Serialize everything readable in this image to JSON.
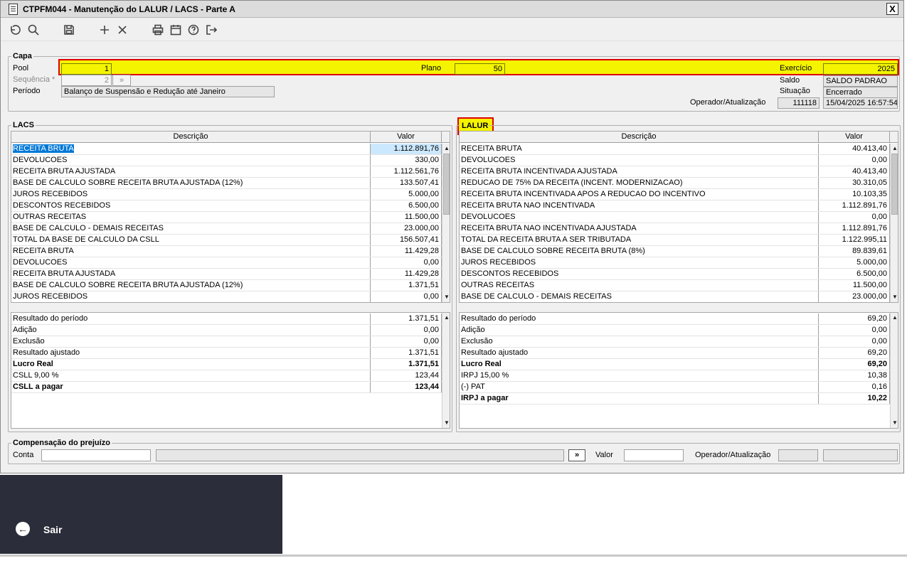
{
  "window": {
    "title": "CTPFM044 - Manutenção do LALUR / LACS - Parte A",
    "close_label": "X"
  },
  "toolbar": {
    "icons": [
      "undo-icon",
      "search-icon",
      "save-icon",
      "add-icon",
      "delete-icon",
      "print-icon",
      "calendar-icon",
      "help-icon",
      "exit-icon"
    ]
  },
  "capa": {
    "legend": "Capa",
    "pool_label": "Pool",
    "pool_value": "1",
    "plano_label": "Plano",
    "plano_value": "50",
    "exercicio_label": "Exercício",
    "exercicio_value": "2025",
    "sequencia_label": "Sequência *",
    "sequencia_value": "2",
    "sequencia_btn": "»",
    "periodo_label": "Período",
    "periodo_value": "Balanço de Suspensão e Redução até Janeiro",
    "saldo_label": "Saldo",
    "saldo_value": "SALDO PADRAO",
    "situacao_label": "Situação",
    "situacao_value": "Encerrado",
    "operador_label": "Operador/Atualização",
    "operador_value": "111118",
    "atualizacao_value": "15/04/2025 16:57:54"
  },
  "lacs": {
    "legend": "LACS",
    "col_desc": "Descrição",
    "col_valor": "Valor",
    "rows": [
      {
        "d": "RECEITA BRUTA",
        "v": "1.112.891,76"
      },
      {
        "d": "DEVOLUCOES",
        "v": "330,00"
      },
      {
        "d": "RECEITA BRUTA AJUSTADA",
        "v": "1.112.561,76"
      },
      {
        "d": "BASE DE CALCULO SOBRE RECEITA BRUTA AJUSTADA (12%)",
        "v": "133.507,41"
      },
      {
        "d": "JUROS RECEBIDOS",
        "v": "5.000,00"
      },
      {
        "d": "DESCONTOS RECEBIDOS",
        "v": "6.500,00"
      },
      {
        "d": "OUTRAS RECEITAS",
        "v": "11.500,00"
      },
      {
        "d": "BASE DE CALCULO - DEMAIS RECEITAS",
        "v": "23.000,00"
      },
      {
        "d": "TOTAL DA BASE DE CALCULO DA CSLL",
        "v": "156.507,41"
      },
      {
        "d": "RECEITA BRUTA",
        "v": "11.429,28"
      },
      {
        "d": "DEVOLUCOES",
        "v": "0,00"
      },
      {
        "d": "RECEITA BRUTA AJUSTADA",
        "v": "11.429,28"
      },
      {
        "d": "BASE DE CALCULO SOBRE RECEITA BRUTA AJUSTADA (12%)",
        "v": "1.371,51"
      },
      {
        "d": "JUROS RECEBIDOS",
        "v": "0,00"
      }
    ],
    "summary": [
      {
        "d": "Resultado do período",
        "v": "1.371,51"
      },
      {
        "d": "Adição",
        "v": "0,00"
      },
      {
        "d": "Exclusão",
        "v": "0,00"
      },
      {
        "d": "Resultado ajustado",
        "v": "1.371,51"
      },
      {
        "d": "Lucro Real",
        "v": "1.371,51",
        "bold": true
      },
      {
        "d": "CSLL 9,00 %",
        "v": "123,44"
      },
      {
        "d": "CSLL a pagar",
        "v": "123,44",
        "bold": true
      }
    ]
  },
  "lalur": {
    "legend": "LALUR",
    "col_desc": "Descrição",
    "col_valor": "Valor",
    "rows": [
      {
        "d": "RECEITA BRUTA",
        "v": "40.413,40"
      },
      {
        "d": "DEVOLUCOES",
        "v": "0,00"
      },
      {
        "d": "RECEITA BRUTA INCENTIVADA AJUSTADA",
        "v": "40.413,40"
      },
      {
        "d": "REDUCAO DE 75% DA RECEITA (INCENT. MODERNIZACAO)",
        "v": "30.310,05"
      },
      {
        "d": "RECEITA BRUTA INCENTIVADA APOS A REDUCAO DO INCENTIVO",
        "v": "10.103,35"
      },
      {
        "d": "RECEITA BRUTA NAO INCENTIVADA",
        "v": "1.112.891,76"
      },
      {
        "d": "DEVOLUCOES",
        "v": "0,00"
      },
      {
        "d": "RECEITA BRUTA NAO INCENTIVADA AJUSTADA",
        "v": "1.112.891,76"
      },
      {
        "d": "TOTAL DA RECEITA BRUTA A SER TRIBUTADA",
        "v": "1.122.995,11"
      },
      {
        "d": "BASE DE CALCULO SOBRE RECEITA BRUTA (8%)",
        "v": "89.839,61"
      },
      {
        "d": "JUROS RECEBIDOS",
        "v": "5.000,00"
      },
      {
        "d": "DESCONTOS RECEBIDOS",
        "v": "6.500,00"
      },
      {
        "d": "OUTRAS RECEITAS",
        "v": "11.500,00"
      },
      {
        "d": "BASE DE CALCULO - DEMAIS RECEITAS",
        "v": "23.000,00"
      }
    ],
    "summary": [
      {
        "d": "Resultado do período",
        "v": "69,20"
      },
      {
        "d": "Adição",
        "v": "0,00"
      },
      {
        "d": "Exclusão",
        "v": "0,00"
      },
      {
        "d": "Resultado ajustado",
        "v": "69,20"
      },
      {
        "d": "Lucro Real",
        "v": "69,20",
        "bold": true
      },
      {
        "d": "IRPJ 15,00 %",
        "v": "10,38"
      },
      {
        "d": "(-) PAT",
        "v": "0,16"
      },
      {
        "d": "IRPJ a pagar",
        "v": "10,22",
        "bold": true
      }
    ]
  },
  "compensacao": {
    "legend": "Compensação do prejuízo",
    "conta_label": "Conta",
    "conta_value": "",
    "conta_btn": "»",
    "valor_label": "Valor",
    "valor_value": "",
    "operador_label": "Operador/Atualização"
  },
  "sidebar": {
    "exit_label": "Sair"
  },
  "colors": {
    "highlight": "#f4f400",
    "highlight_border": "#e00000",
    "selection": "#0078d7",
    "sidebar_bg": "#2b2d3a"
  }
}
